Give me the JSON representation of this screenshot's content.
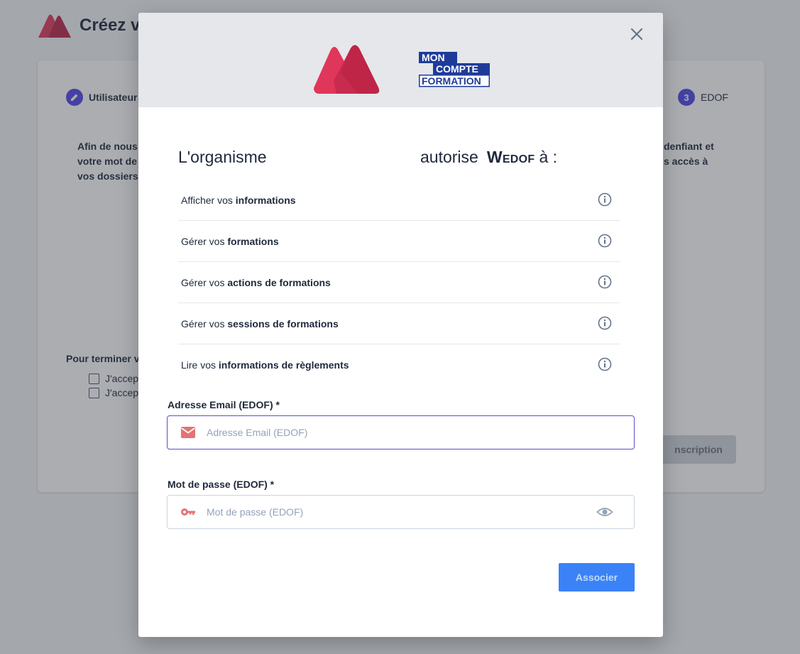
{
  "background": {
    "title": "Créez v",
    "steps": [
      {
        "label": "Utilisateur"
      },
      {
        "number": "3",
        "label": "EDOF"
      }
    ],
    "intro_left": [
      "Afin de nous",
      "votre mot de",
      "vos dossiers."
    ],
    "intro_right": [
      "denfiant et",
      "s accès à"
    ],
    "finish_label": "Pour terminer v",
    "checkboxes": [
      "J'accep",
      "J'accep"
    ],
    "submit_label": "nscription"
  },
  "modal": {
    "partner_logo_lines": [
      "MON",
      "COMPTE",
      "FORMATION"
    ],
    "auth_left": "L'organisme",
    "auth_word": "autorise",
    "auth_app": "Wedof",
    "auth_suffix": "à :",
    "permissions": [
      {
        "prefix": "Afficher vos",
        "bold": "informations"
      },
      {
        "prefix": "Gérer vos",
        "bold": "formations"
      },
      {
        "prefix": "Gérer vos",
        "bold": "actions de formations"
      },
      {
        "prefix": "Gérer vos",
        "bold": "sessions de formations"
      },
      {
        "prefix": "Lire vos",
        "bold": "informations de règlements"
      }
    ],
    "email": {
      "label": "Adresse Email (EDOF) *",
      "placeholder": "Adresse Email (EDOF)",
      "value": ""
    },
    "password": {
      "label": "Mot de passe (EDOF) *",
      "placeholder": "Mot de passe (EDOF)",
      "value": ""
    },
    "submit_label": "Associer"
  },
  "colors": {
    "brand_red": "#e0365a",
    "accent_indigo": "#4f46e5",
    "mcf_blue": "#1f3b9a",
    "button_blue": "#3b82f6",
    "icon_red": "#e57373"
  }
}
